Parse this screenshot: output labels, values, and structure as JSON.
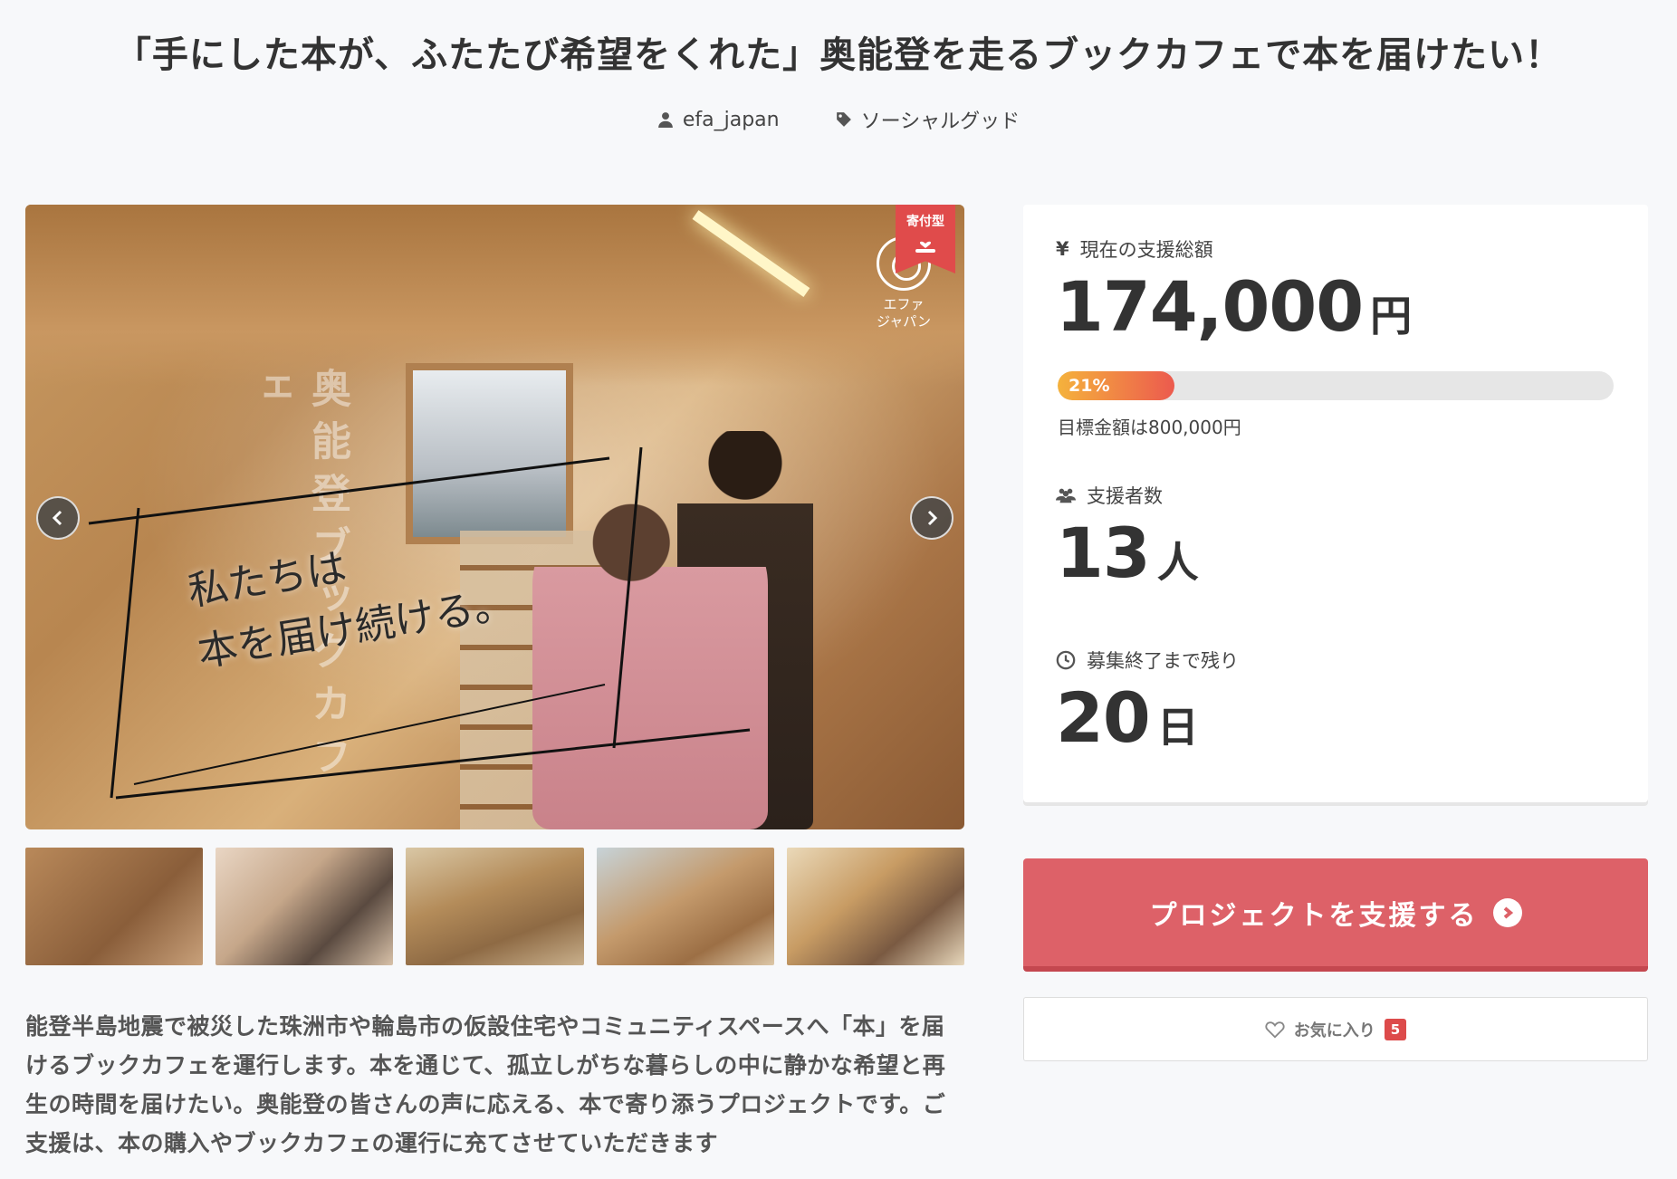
{
  "page": {
    "title": "「手にした本が、ふたたび希望をくれた」奥能登を走るブックカフェで本を届けたい！",
    "author": "efa_japan",
    "category": "ソーシャルグッド"
  },
  "hero": {
    "overlay_text": "私たちは\n本を届け続ける。",
    "vertical_text": "奥能登ブックカフェ",
    "logo_text": "エファ\nジャパン",
    "badge": "寄付型",
    "prev_icon": "chevron-left-icon",
    "next_icon": "chevron-right-icon"
  },
  "thumbnails": [
    {
      "label": "thumbnail-1"
    },
    {
      "label": "thumbnail-2"
    },
    {
      "label": "thumbnail-3"
    },
    {
      "label": "thumbnail-4"
    },
    {
      "label": "thumbnail-5"
    }
  ],
  "description": "能登半島地震で被災した珠洲市や輪島市の仮設住宅やコミュニティスペースへ「本」を届けるブックカフェを運行します。本を通じて、孤立しがちな暮らしの中に静かな希望と再生の時間を届けたい。奥能登の皆さんの声に応える、本で寄り添うプロジェクトです。ご支援は、本の購入やブックカフェの運行に充てさせていただきます",
  "stats": {
    "total_label": "現在の支援総額",
    "total_symbol": "¥",
    "total_value": "174,000",
    "total_unit": "円",
    "progress_percent": 21,
    "progress_label": "21%",
    "goal_text": "目標金額は800,000円",
    "supporters_label": "支援者数",
    "supporters_value": "13",
    "supporters_unit": "人",
    "remaining_label": "募集終了まで残り",
    "remaining_value": "20",
    "remaining_unit": "日"
  },
  "actions": {
    "support_label": "プロジェクトを支援する",
    "favorite_label": "お気に入り",
    "favorite_count": "5"
  },
  "colors": {
    "accent": "#dd6168",
    "badge": "#e04b4b",
    "progress_start": "#f5b23c",
    "progress_end": "#ec5a4e",
    "background": "#f7f8fa"
  }
}
